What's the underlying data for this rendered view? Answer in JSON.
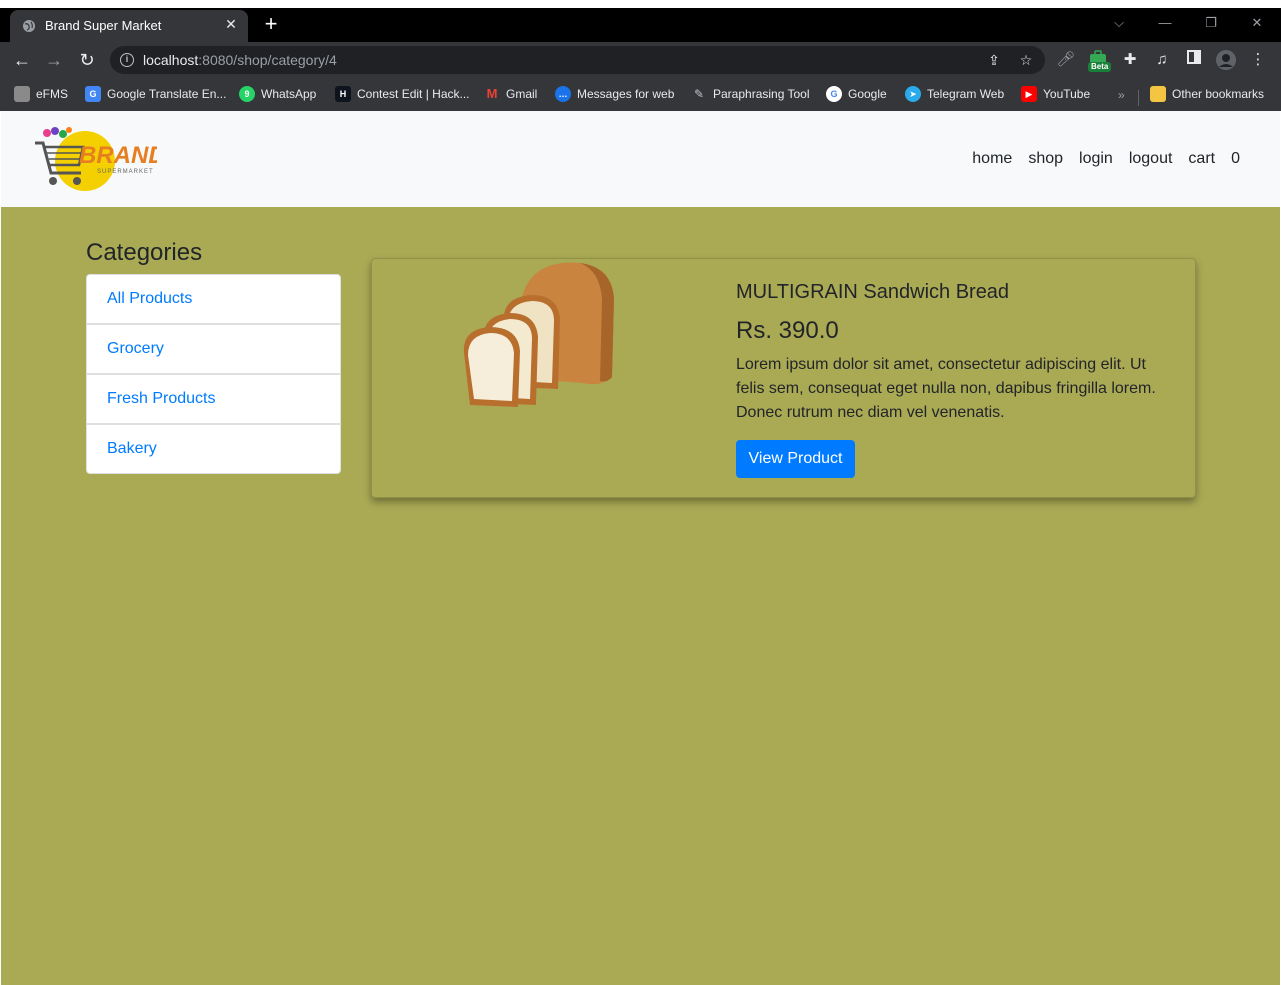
{
  "browser": {
    "tab_title": "Brand Super Market",
    "url_host": "localhost",
    "url_rest": ":8080/shop/category/4",
    "beta_label": "Beta",
    "bookmarks": [
      {
        "label": "eFMS",
        "icon": "efms-icon",
        "color": "#8a8a8a"
      },
      {
        "label": "Google Translate En...",
        "icon": "google-translate-icon",
        "color": "#4285f4"
      },
      {
        "label": "WhatsApp",
        "icon": "whatsapp-icon",
        "color": "#25d366"
      },
      {
        "label": "Contest Edit | Hack...",
        "icon": "hackerrank-icon",
        "color": "#1ba94c"
      },
      {
        "label": "Gmail",
        "icon": "gmail-icon",
        "color": "#ea4335"
      },
      {
        "label": "Messages for web",
        "icon": "messages-icon",
        "color": "#1a73e8"
      },
      {
        "label": "Paraphrasing Tool",
        "icon": "quill-icon",
        "color": "#6b6b6b"
      },
      {
        "label": "Google",
        "icon": "google-icon",
        "color": "#ffffff"
      },
      {
        "label": "Telegram Web",
        "icon": "telegram-icon",
        "color": "#2aabee"
      },
      {
        "label": "YouTube",
        "icon": "youtube-icon",
        "color": "#ff0000"
      }
    ],
    "other_bookmarks": "Other bookmarks"
  },
  "site": {
    "logo_text": "BRAND",
    "logo_subtext": "SUPERMARKET",
    "nav": [
      "home",
      "shop",
      "login",
      "logout",
      "cart",
      "0"
    ],
    "colors": {
      "page_bg": "#aaaa55",
      "link": "#007bff",
      "button": "#007bff"
    }
  },
  "categories": {
    "heading": "Categories",
    "items": [
      "All Products",
      "Grocery",
      "Fresh Products",
      "Bakery"
    ]
  },
  "product": {
    "name": "MULTIGRAIN Sandwich Bread",
    "price": "Rs. 390.0",
    "description": "Lorem ipsum dolor sit amet, consectetur adipiscing elit. Ut felis sem, consequat eget nulla non, dapibus fringilla lorem. Donec rutrum nec diam vel venenatis.",
    "button": "View Product"
  }
}
